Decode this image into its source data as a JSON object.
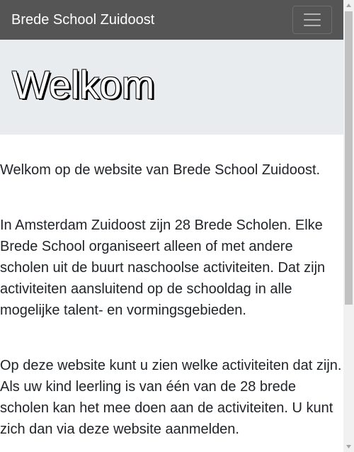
{
  "navbar": {
    "brand": "Brede School Zuidoost",
    "toggle_icon": "hamburger-menu-icon"
  },
  "jumbotron": {
    "title": "Welkom"
  },
  "content": {
    "paragraphs": [
      "Welkom op de website van Brede School Zuidoost.",
      "In Amsterdam Zuidoost zijn 28 Brede Scholen. Elke Brede School organiseert alleen of met andere scholen uit de buurt naschoolse activiteiten. Dat zijn activiteiten aansluitend op de schooldag in alle mogelijke talent- en vormingsgebieden.",
      "Op deze website kunt u zien welke activiteiten dat zijn. Als uw kind leerling is van één van de 28 brede scholen kan het mee doen aan de activiteiten. U kunt zich dan via deze website aanmelden."
    ]
  },
  "colors": {
    "navbar_bg": "#555555",
    "jumbotron_bg": "#e9ecef",
    "text": "#212529"
  }
}
